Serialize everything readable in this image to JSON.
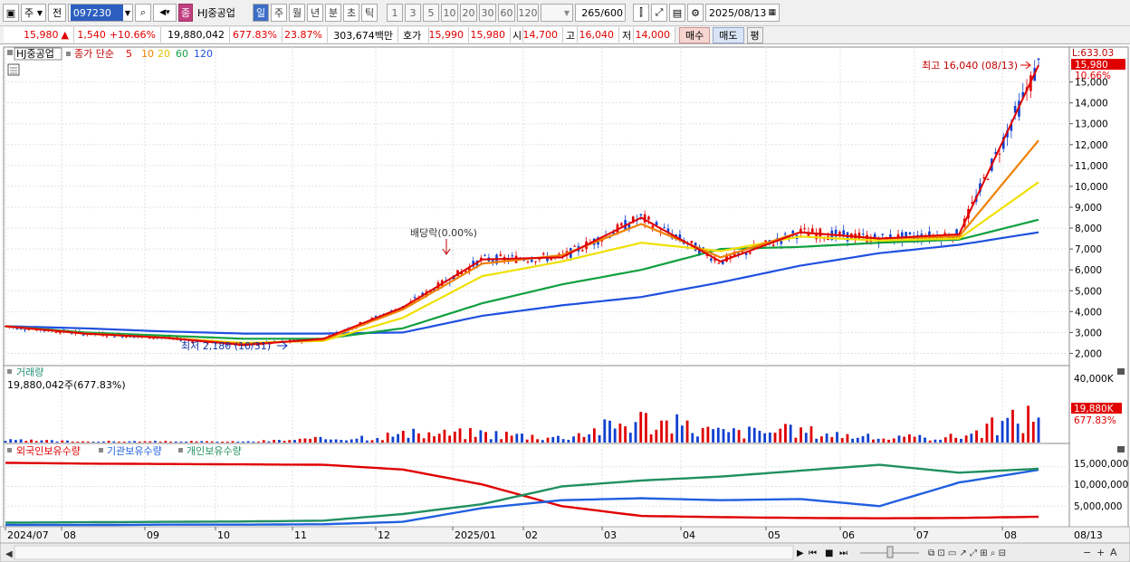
{
  "toolbar": {
    "market": "주",
    "prev_label": "전",
    "code": "097230",
    "stock_name": "HJ중공업",
    "chart_type": "종",
    "periods": [
      "일",
      "주",
      "월",
      "년",
      "분",
      "초",
      "틱"
    ],
    "selected_period": "일",
    "intervals": [
      "1",
      "3",
      "5",
      "10",
      "20",
      "30",
      "60",
      "120"
    ],
    "count": "265",
    "count_max": "/600",
    "date": "2025/08/13"
  },
  "info": {
    "price": "15,980",
    "change_arrow": "▲",
    "change": "1,540",
    "change_pct": "+10.66%",
    "volume": "19,880,042",
    "volume_ratio": "677.83%",
    "turnover": "23.87%",
    "amount": "303,674백만",
    "quote_label": "호가",
    "ask": "15,990",
    "bid": "15,980",
    "open_label": "시",
    "open": "14,700",
    "high_label": "고",
    "high": "16,040",
    "low_label": "저",
    "low": "14,000",
    "buy": "매수",
    "sell": "매도",
    "eval": "평"
  },
  "price_panel": {
    "name": "HJ중공업",
    "ma_label": "종가 단순",
    "ma_periods": [
      "5",
      "10",
      "20",
      "60",
      "120"
    ],
    "ma_colors": [
      "#e00000",
      "#f08000",
      "#f0e000",
      "#10a040",
      "#2050e0"
    ],
    "corner_label": "L:633.03",
    "current_price_tag": "15,980",
    "current_pct_tag": "10.66%",
    "high_note": "최고 16,040 (08/13)",
    "low_note": "최저 2,180 (10/31)",
    "dividend_note": "배당락(0.00%)",
    "y_ticks": [
      "15,000",
      "14,000",
      "13,000",
      "12,000",
      "11,000",
      "10,000",
      "9,000",
      "8,000",
      "7,000",
      "6,000",
      "5,000",
      "4,000",
      "3,000",
      "2,000"
    ]
  },
  "volume_panel": {
    "title": "거래량",
    "value_text": "19,880,042주(677.83%)",
    "tick": "40,000K",
    "tag": "19,880K",
    "tag_pct": "677.83%"
  },
  "holdings_panel": {
    "legend": [
      "외국인보유수량",
      "기관보유수량",
      "개인보유수량"
    ],
    "legend_colors": [
      "#e00000",
      "#2060e0",
      "#209060"
    ],
    "ticks": [
      "15,000,000",
      "10,000,000",
      "5,000,000"
    ]
  },
  "x_axis": {
    "labels": [
      "2024/07",
      "08",
      "09",
      "10",
      "11",
      "12",
      "2025/01",
      "02",
      "03",
      "04",
      "05",
      "06",
      "07",
      "08"
    ],
    "end_label": "08/13"
  },
  "chart_data": [
    {
      "type": "line",
      "title": "",
      "ylim": [
        1500,
        16500
      ],
      "x": [
        "2024-07",
        "2024-08",
        "2024-09",
        "2024-10",
        "2024-11",
        "2024-12",
        "2025-01",
        "2025-02",
        "2025-03",
        "2025-04",
        "2025-05",
        "2025-06",
        "2025-07",
        "2025-08-13"
      ],
      "series": [
        {
          "name": "5",
          "values": [
            3300,
            2950,
            2750,
            2400,
            2700,
            4200,
            6500,
            6600,
            8500,
            6400,
            7800,
            7500,
            7700,
            15800
          ]
        },
        {
          "name": "10",
          "values": [
            3300,
            2950,
            2750,
            2450,
            2650,
            4100,
            6300,
            6700,
            8200,
            6600,
            7800,
            7500,
            7600,
            12200
          ]
        },
        {
          "name": "20",
          "values": [
            3300,
            2950,
            2750,
            2500,
            2600,
            3700,
            5700,
            6400,
            7300,
            6900,
            7600,
            7400,
            7500,
            10200
          ]
        },
        {
          "name": "60",
          "values": [
            3300,
            3000,
            2850,
            2700,
            2700,
            3200,
            4400,
            5300,
            6000,
            7000,
            7100,
            7300,
            7450,
            8400
          ]
        },
        {
          "name": "120",
          "values": [
            3300,
            3200,
            3050,
            2950,
            2950,
            3000,
            3800,
            4300,
            4700,
            5400,
            6200,
            6800,
            7200,
            7800
          ]
        }
      ]
    },
    {
      "type": "bar",
      "title": "",
      "ylim": [
        0,
        45000
      ],
      "categories": [
        "2024-07",
        "2024-08",
        "2024-09",
        "2024-10",
        "2024-11",
        "2024-12",
        "2025-01",
        "2025-02",
        "2025-03",
        "2025-04",
        "2025-05",
        "2025-06",
        "2025-07",
        "2025-08"
      ],
      "values": [
        1500,
        800,
        700,
        600,
        2500,
        5500,
        6500,
        3500,
        16000,
        7000,
        8000,
        3000,
        4000,
        19880
      ]
    },
    {
      "type": "line",
      "title": "",
      "ylim": [
        0,
        20000000
      ],
      "x": [
        "2024-07",
        "2024-08",
        "2024-09",
        "2024-10",
        "2024-11",
        "2024-12",
        "2025-01",
        "2025-02",
        "2025-03",
        "2025-04",
        "2025-05",
        "2025-06",
        "2025-07",
        "2025-08"
      ],
      "series": [
        {
          "name": "외국인보유수량",
          "values": [
            16000000,
            15800000,
            15700000,
            15600000,
            15500000,
            14300000,
            10500000,
            5000000,
            2500000,
            2200000,
            2000000,
            1900000,
            2000000,
            2300000
          ]
        },
        {
          "name": "기관보유수량",
          "values": [
            200000,
            200000,
            300000,
            300000,
            400000,
            1000000,
            4500000,
            6500000,
            7000000,
            6500000,
            6800000,
            5000000,
            11000000,
            14200000
          ]
        },
        {
          "name": "개인보유수량",
          "values": [
            800000,
            900000,
            1000000,
            1100000,
            1300000,
            3000000,
            5500000,
            10000000,
            11500000,
            12500000,
            14000000,
            15500000,
            13500000,
            14500000
          ]
        }
      ]
    }
  ]
}
